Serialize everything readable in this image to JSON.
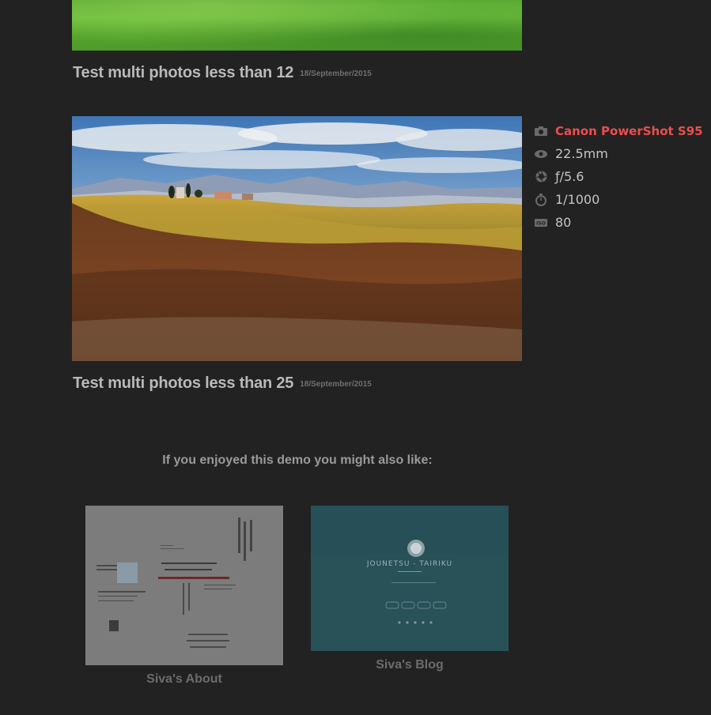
{
  "posts": [
    {
      "title": "Test multi photos less than 12",
      "date": "18/September/2015"
    },
    {
      "title": "Test multi photos less than 25",
      "date": "18/September/2015"
    }
  ],
  "exif": {
    "camera": "Canon PowerShot S95",
    "focal_length": "22.5mm",
    "aperture": "ƒ/5.6",
    "shutter": "1/1000",
    "iso": "80",
    "icons": [
      "camera-icon",
      "eye-icon",
      "aperture-icon",
      "stopwatch-icon",
      "iso-icon"
    ],
    "accent_color": "#ec4d4d"
  },
  "related": {
    "heading": "If you enjoyed this demo you might also like:",
    "cards": [
      {
        "label": "Siva's About"
      },
      {
        "label": "Siva's Blog",
        "thumb_title": "JOUNETSU - TAIRIKU"
      }
    ]
  }
}
